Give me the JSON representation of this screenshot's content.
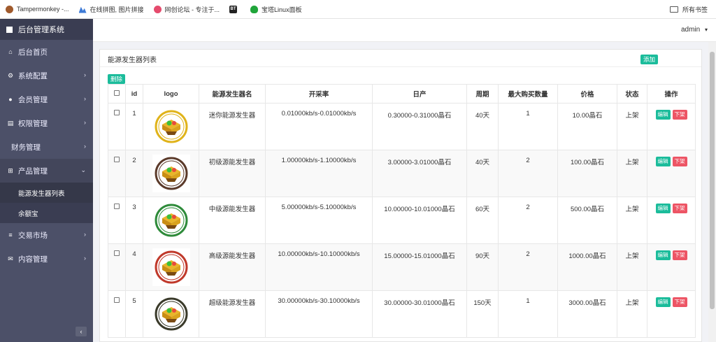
{
  "bookmarks": [
    {
      "label": "Tampermonkey -...",
      "icon": "tampermonkey-icon"
    },
    {
      "label": "在线拼图, 图片拼接",
      "icon": "picture-icon"
    },
    {
      "label": "网创论坛 - 专注于...",
      "icon": "forum-icon"
    },
    {
      "label": "",
      "icon": "bt-icon",
      "badge": "BT"
    },
    {
      "label": "宝塔Linux面板",
      "icon": "bt-panel-icon"
    }
  ],
  "bookmarks_right": "所有书签",
  "sidebar": {
    "brand": "后台管理系统",
    "items": [
      {
        "label": "后台首页",
        "icon": "home-icon",
        "glyph": "⌂"
      },
      {
        "label": "系统配置",
        "icon": "gears-icon",
        "glyph": "⚙",
        "chevron": "›"
      },
      {
        "label": "会员管理",
        "icon": "user-icon",
        "glyph": "●",
        "chevron": "›"
      },
      {
        "label": "权限管理",
        "icon": "id-card-icon",
        "glyph": "▤",
        "chevron": "›"
      },
      {
        "label": "财务管理",
        "icon": "",
        "glyph": "",
        "chevron": "›"
      },
      {
        "label": "产品管理",
        "icon": "windows-icon",
        "glyph": "⊞",
        "chevron": "⌄"
      }
    ],
    "sub_items": [
      {
        "label": "能源发生器列表"
      },
      {
        "label": "余额宝"
      }
    ],
    "items_after": [
      {
        "label": "交易市场",
        "icon": "list-icon",
        "glyph": "≡",
        "chevron": "›"
      },
      {
        "label": "内容管理",
        "icon": "envelope-icon",
        "glyph": "✉",
        "chevron": "›"
      }
    ],
    "collapse": "‹"
  },
  "header": {
    "user": "admin",
    "caret": "▾"
  },
  "card": {
    "title": "能源发生器列表",
    "add_label": "添加",
    "delete_label": "删除"
  },
  "table": {
    "headers": [
      "",
      "id",
      "logo",
      "能源发生器名",
      "开采率",
      "日产",
      "周期",
      "最大购买数量",
      "价格",
      "状态",
      "操作"
    ],
    "edit_label": "编辑",
    "off_label": "下架",
    "rows": [
      {
        "id": "1",
        "name": "迷你能源发生器",
        "rate": "0.01000kb/s-0.01000kb/s",
        "daily": "0.30000-0.31000晶石",
        "period": "40天",
        "max": "1",
        "price": "10.00晶石",
        "status": "上架",
        "ring": "#e0b31a"
      },
      {
        "id": "2",
        "name": "初级源能发生器",
        "rate": "1.00000kb/s-1.10000kb/s",
        "daily": "3.00000-3.01000晶石",
        "period": "40天",
        "max": "2",
        "price": "100.00晶石",
        "status": "上架",
        "ring": "#5b3a2a"
      },
      {
        "id": "3",
        "name": "中级源能发生器",
        "rate": "5.00000kb/s-5.10000kb/s",
        "daily": "10.00000-10.01000晶石",
        "period": "60天",
        "max": "2",
        "price": "500.00晶石",
        "status": "上架",
        "ring": "#2e8b3a"
      },
      {
        "id": "4",
        "name": "高级源能发生器",
        "rate": "10.00000kb/s-10.10000kb/s",
        "daily": "15.00000-15.01000晶石",
        "period": "90天",
        "max": "2",
        "price": "1000.00晶石",
        "status": "上架",
        "ring": "#c0392b"
      },
      {
        "id": "5",
        "name": "超级能源发生器",
        "rate": "30.00000kb/s-30.10000kb/s",
        "daily": "30.00000-30.01000晶石",
        "period": "150天",
        "max": "1",
        "price": "3000.00晶石",
        "status": "上架",
        "ring": "#3a3a2a"
      }
    ]
  }
}
